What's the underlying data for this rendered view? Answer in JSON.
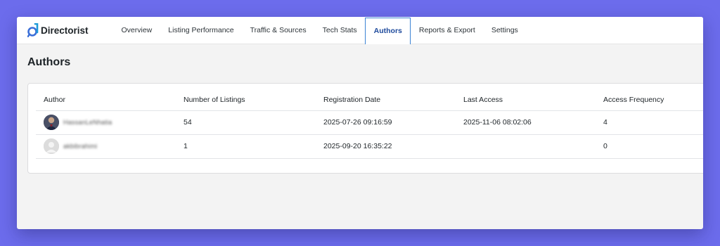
{
  "app": {
    "name": "Directorist",
    "accent": "#3a82d4",
    "active_tab_color": "#1e4a9c"
  },
  "nav": {
    "items": [
      {
        "label": "Overview"
      },
      {
        "label": "Listing Performance"
      },
      {
        "label": "Traffic & Sources"
      },
      {
        "label": "Tech Stats"
      },
      {
        "label": "Authors",
        "active": true
      },
      {
        "label": "Reports & Export"
      },
      {
        "label": "Settings"
      }
    ]
  },
  "page": {
    "title": "Authors"
  },
  "table": {
    "headers": [
      "Author",
      "Number of Listings",
      "Registration Date",
      "Last Access",
      "Access Frequency"
    ],
    "rows": [
      {
        "author": "HassanLeNhatia",
        "avatar": "user-photo-avatar",
        "listings": "54",
        "registered": "2025-07-26 09:16:59",
        "last_access": "2025-11-06 08:02:06",
        "frequency": "4"
      },
      {
        "author": "akbibrahimi",
        "avatar": "default-user-avatar",
        "listings": "1",
        "registered": "2025-09-20 16:35:22",
        "last_access": "",
        "frequency": "0"
      }
    ]
  }
}
